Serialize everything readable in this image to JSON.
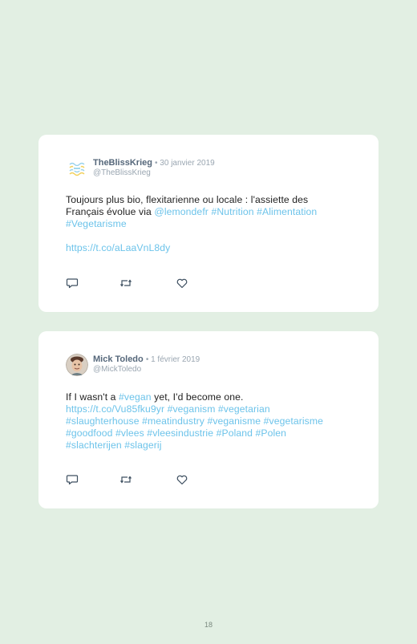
{
  "tweets": [
    {
      "display_name": "TheBlissKrieg",
      "date": "• 30 janvier 2019",
      "handle": "@TheBlissKrieg",
      "avatar_icon": "blissfood-logo-icon",
      "line1_text": "Toujours plus bio, flexitarienne ou locale : l'assiette des",
      "line2_text": "Français évolue via ",
      "mention": "@lemondefr",
      "hashtag_1": "#Nutrition",
      "hashtag_2": "#Alimentation",
      "hashtag_3": "#Vegetarisme",
      "url": "https://t.co/aLaaVnL8dy"
    },
    {
      "display_name": "Mick Toledo",
      "date": "• 1 février 2019",
      "handle": "@MickToledo",
      "avatar_icon": "user-photo-avatar",
      "text_before": "If I wasn't a ",
      "hashtag_vegan": "#vegan",
      "text_after": " yet, I'd become one.",
      "url": "https://t.co/Vu85fku9yr",
      "hashtags_line2": "#veganism #vegetarian",
      "hashtags_line3": "#slaughterhouse #meatindustry #veganisme #vegetarisme",
      "hashtags_line4": "#goodfood #vlees #vleesindustrie #Poland #Polen",
      "hashtags_line5": "#slachterijen #slagerij"
    }
  ],
  "actions": {
    "reply_icon": "reply-icon",
    "retweet_icon": "retweet-icon",
    "like_icon": "heart-icon"
  },
  "page_number": "18",
  "colors": {
    "background": "#e2efe3",
    "card": "#ffffff",
    "link": "#6cc3ea",
    "name": "#55677a",
    "meta": "#9aa6b1"
  }
}
